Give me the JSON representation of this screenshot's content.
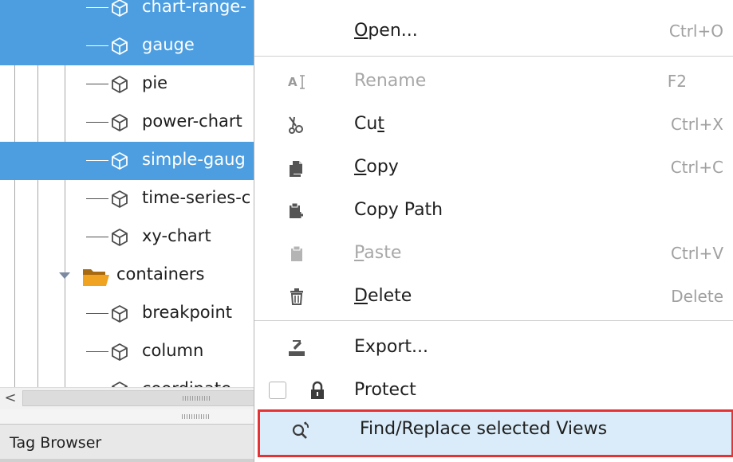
{
  "tree": {
    "items": [
      {
        "label": "chart-range-",
        "selected": true,
        "type": "view"
      },
      {
        "label": "gauge",
        "selected": true,
        "type": "view"
      },
      {
        "label": "pie",
        "selected": false,
        "type": "view"
      },
      {
        "label": "power-chart",
        "selected": false,
        "type": "view"
      },
      {
        "label": "simple-gaug",
        "selected": true,
        "type": "view"
      },
      {
        "label": "time-series-c",
        "selected": false,
        "type": "view"
      },
      {
        "label": "xy-chart",
        "selected": false,
        "type": "view"
      },
      {
        "label": "containers",
        "selected": false,
        "type": "folder"
      },
      {
        "label": "breakpoint",
        "selected": false,
        "type": "view"
      },
      {
        "label": "column",
        "selected": false,
        "type": "view"
      },
      {
        "label": "coordinate",
        "selected": false,
        "type": "view"
      }
    ],
    "scroll_left_arrow": "<",
    "tag_browser_label": "Tag Browser"
  },
  "menu": {
    "open": {
      "pre": "",
      "u": "O",
      "post": "pen...",
      "shortcut": "Ctrl+O",
      "icon": "none"
    },
    "rename": {
      "label": "Rename",
      "shortcut": "F2",
      "icon": "rename-text-cursor-icon"
    },
    "cut": {
      "pre": "Cu",
      "u": "t",
      "post": "",
      "shortcut": "Ctrl+X",
      "icon": "scissors-icon"
    },
    "copy": {
      "pre": "",
      "u": "C",
      "post": "opy",
      "shortcut": "Ctrl+C",
      "icon": "copy-icon"
    },
    "copy_path": {
      "label": "Copy Path",
      "shortcut": "",
      "icon": "clipboard-plus-icon"
    },
    "paste": {
      "pre": "",
      "u": "P",
      "post": "aste",
      "shortcut": "Ctrl+V",
      "icon": "clipboard-icon"
    },
    "delete": {
      "pre": "",
      "u": "D",
      "post": "elete",
      "shortcut": "Delete",
      "icon": "trash-icon"
    },
    "export": {
      "label": "Export...",
      "shortcut": "",
      "icon": "export-icon"
    },
    "protect": {
      "label": "Protect",
      "checked": false,
      "icon": "lock-icon"
    },
    "find_replace": {
      "label": "Find/Replace selected Views",
      "icon": "find-replace-icon"
    }
  },
  "colors": {
    "selection": "#4c9ee0",
    "menu_highlight": "#daecf9",
    "highlight_outline": "#e53333",
    "disabled_text": "#a8a8a8"
  }
}
